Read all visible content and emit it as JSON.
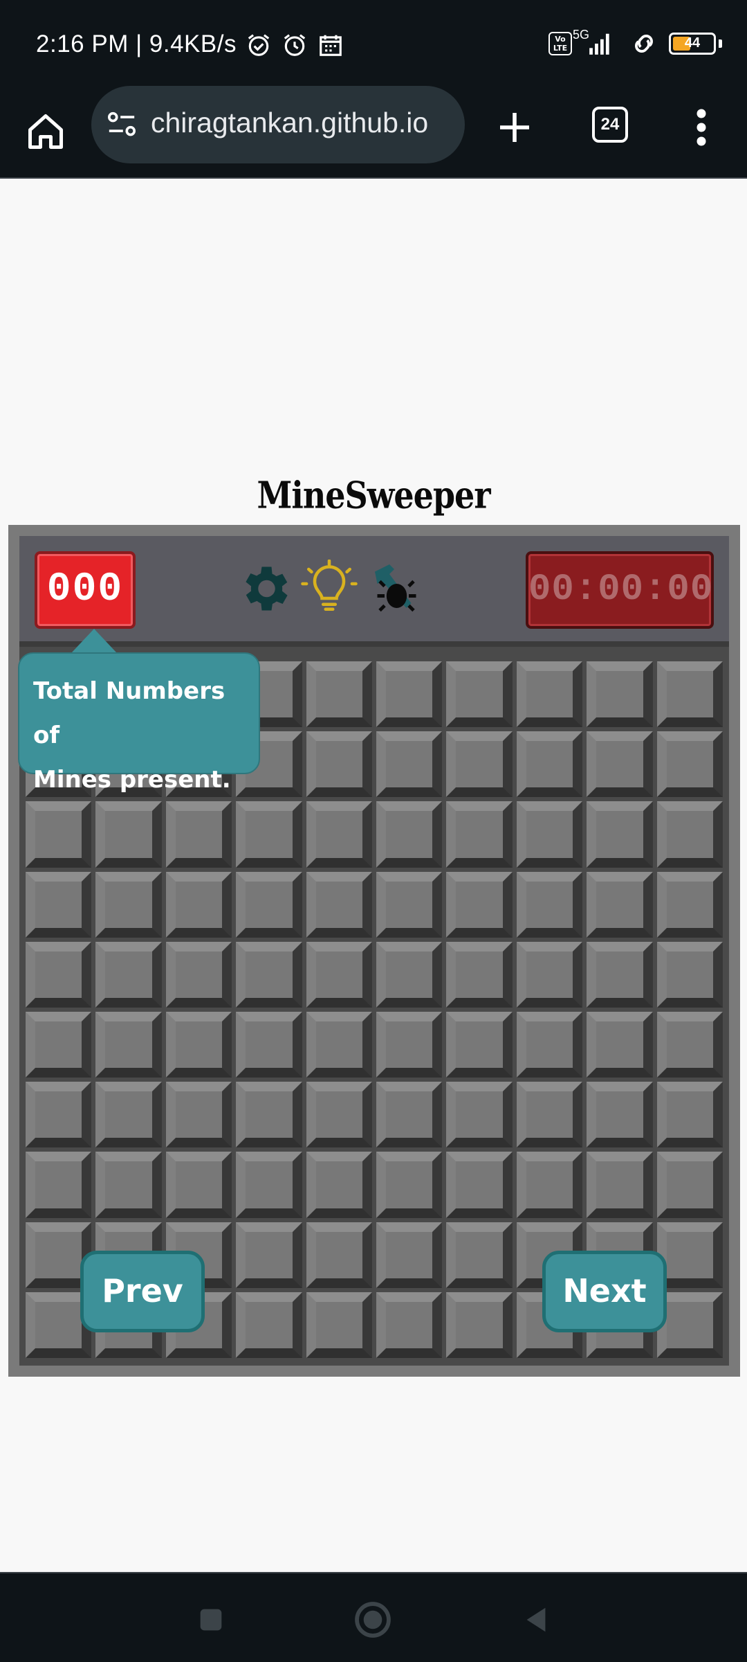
{
  "status_bar": {
    "time": "2:16 PM | 9.4KB/s",
    "volte": "Vo LTE",
    "network": "5G",
    "battery": "44",
    "battery_level": 0.44
  },
  "browser": {
    "url": "chiragtankan.github.io",
    "tab_count": "24"
  },
  "page": {
    "title": "MineSweeper"
  },
  "game": {
    "mine_counter": "000",
    "timer": "00:00:00",
    "tools": [
      "gear-icon",
      "lightbulb-icon",
      "hammer-bug-icon"
    ],
    "grid_rows": 10,
    "grid_cols": 10
  },
  "tutorial": {
    "tooltip_line1": "Total Numbers of",
    "tooltip_line2": "Mines present.",
    "prev_label": "Prev",
    "next_label": "Next"
  },
  "colors": {
    "accent_teal": "#3d9199",
    "counter_red": "#e52328",
    "timer_red": "#8a1c1f",
    "bulb_yellow": "#d9b21f"
  }
}
